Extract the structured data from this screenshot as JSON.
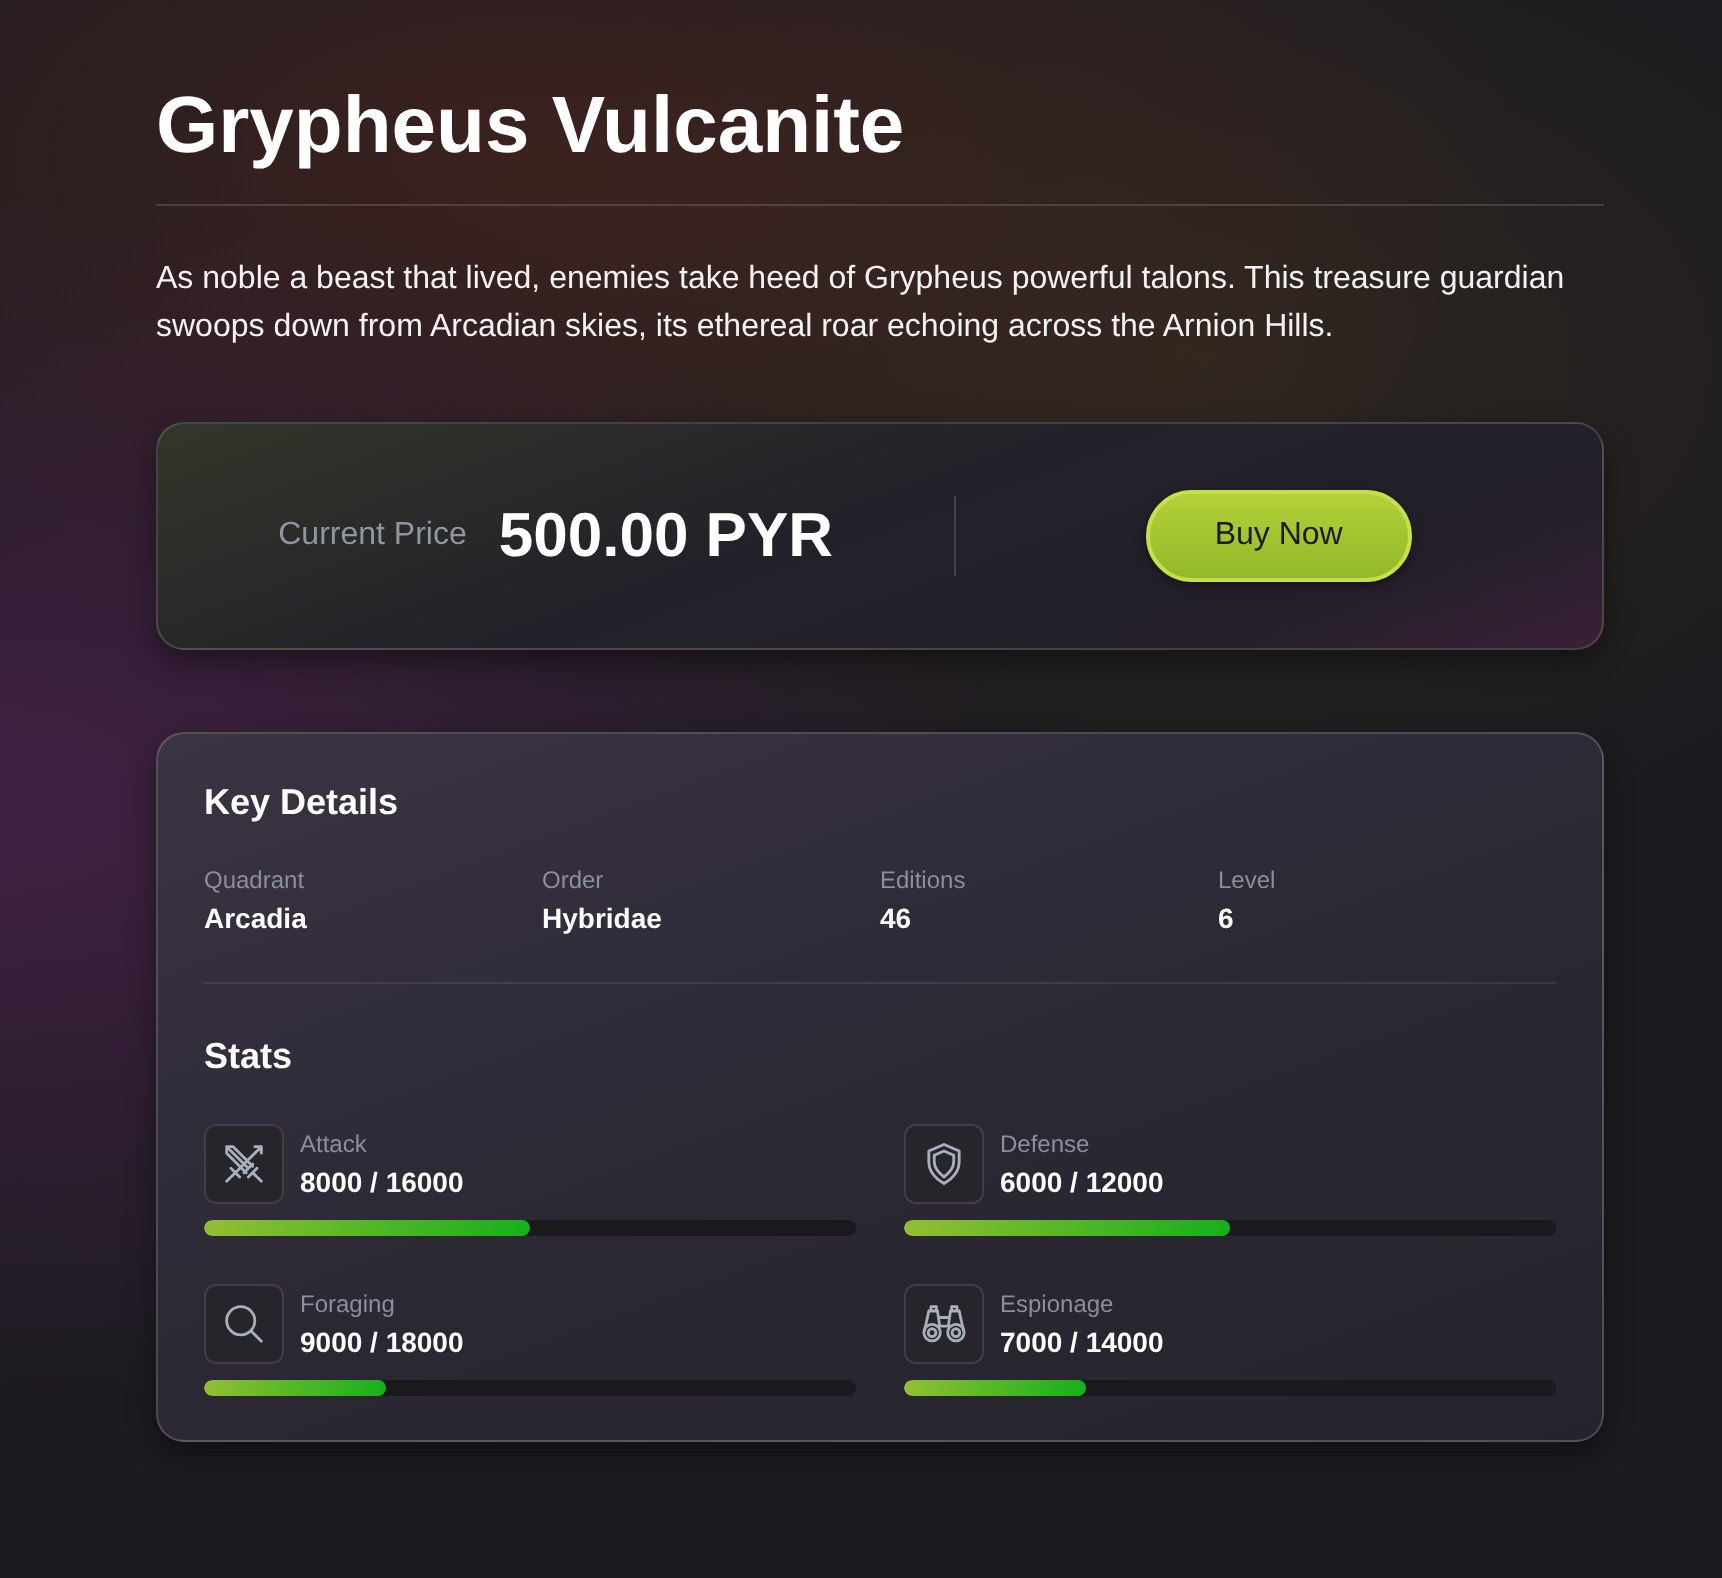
{
  "title": "Grypheus Vulcanite",
  "description": "As noble a beast that lived, enemies take heed of Grypheus powerful talons. This treasure guardian swoops down from Arcadian skies, its ethereal roar echoing across the Arnion Hills.",
  "price": {
    "label": "Current Price",
    "value": "500.00 PYR",
    "button": "Buy Now"
  },
  "key_details": {
    "heading": "Key Details",
    "items": [
      {
        "label": "Quadrant",
        "value": "Arcadia"
      },
      {
        "label": "Order",
        "value": "Hybridae"
      },
      {
        "label": "Editions",
        "value": "46"
      },
      {
        "label": "Level",
        "value": "6"
      }
    ]
  },
  "stats": {
    "heading": "Stats",
    "items": [
      {
        "label": "Attack",
        "value": "8000 / 16000",
        "level": 0.5
      },
      {
        "label": "Defense",
        "value": "6000 / 12000",
        "level": 0.5
      },
      {
        "label": "Foraging",
        "value": "9000 / 18000",
        "level": 0.28
      },
      {
        "label": "Espionage",
        "value": "7000 / 14000",
        "level": 0.28
      }
    ]
  }
}
